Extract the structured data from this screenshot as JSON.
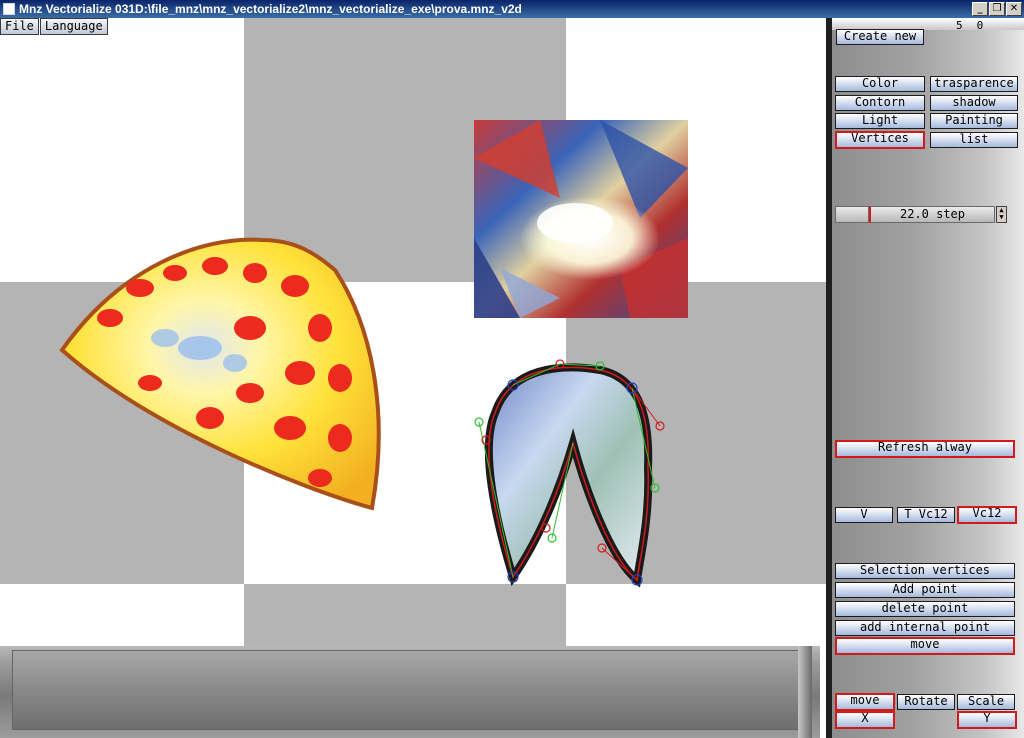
{
  "window": {
    "title": "Mnz Vectorialize 031D:\\file_mnz\\mnz_vectorialize2\\mnz_vectorialize_exe\\prova.mnz_v2d",
    "min_glyph": "_",
    "max_glyph": "❐",
    "close_glyph": "✕"
  },
  "menu": {
    "file": "File",
    "language": "Language"
  },
  "panel": {
    "coord_x": "5",
    "coord_y": "0",
    "create_new": "Create new",
    "color": "Color",
    "trasparence": "trasparence",
    "contorn": "Contorn",
    "shadow": "shadow",
    "light": "Light",
    "painting": "Painting",
    "vertices": "Vertices",
    "list": "list",
    "step_value": "22.0 step",
    "refresh": "Refresh alway",
    "v": "V",
    "t_vc12": "T Vc12",
    "vc12": "Vc12",
    "selection_vertices": "Selection vertices",
    "add_point": "Add point",
    "delete_point": "delete point",
    "add_internal_point": "add internal point",
    "move_vertex": "move",
    "move": "move",
    "rotate": "Rotate",
    "scale": "Scale",
    "x": "X",
    "y": "Y"
  },
  "colors": {
    "accent_red": "#d21a1a",
    "title_blue": "#0a246a",
    "checker_grey": "#b4b4b4"
  }
}
